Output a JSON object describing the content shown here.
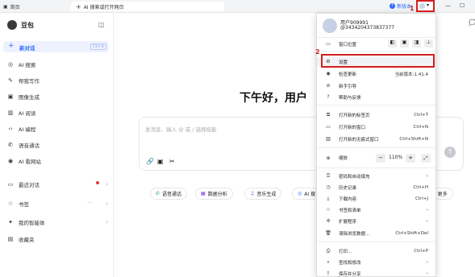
{
  "titlebar": {
    "home_tab": "首页",
    "new_tab": "AI 搜索或打开网页",
    "update_label": "新版本",
    "update_count": "1"
  },
  "sidebar": {
    "brand": "豆包",
    "new_chat": "新对话",
    "new_chat_shortcut": "Ctrl K",
    "items": [
      {
        "icon": "ai-search-icon",
        "glyph": "◎",
        "label": "AI 搜索"
      },
      {
        "icon": "pen-icon",
        "glyph": "✎",
        "label": "帮我写作"
      },
      {
        "icon": "image-icon",
        "glyph": "▣",
        "label": "图像生成"
      },
      {
        "icon": "book-icon",
        "glyph": "▥",
        "label": "AI 阅读"
      },
      {
        "icon": "code-icon",
        "glyph": "‹›",
        "label": "AI 编程"
      },
      {
        "icon": "phone-icon",
        "glyph": "✆",
        "label": "语音通话"
      },
      {
        "icon": "globe-icon",
        "glyph": "◉",
        "label": "AI 看网站"
      }
    ],
    "recent": "最近对话",
    "bookmarks": "书签",
    "agents": "我的智能体",
    "favorites": "收藏夹"
  },
  "main": {
    "greeting": "下午好，用户",
    "placeholder": "发消息、输入 @ 或 / 选择技能",
    "chips": [
      "语音通话",
      "数据分析",
      "音乐生成",
      "AI 搜",
      "更多"
    ]
  },
  "menu": {
    "user_name": "用户909991",
    "user_handle": "@3434204373837377",
    "window_position": "窗口位置",
    "settings": "设置",
    "check_update": "检查更新",
    "version": "当前版本:1.41.4",
    "guide": "新手引导",
    "help": "帮助与反馈",
    "new_tab": "打开新的标签页",
    "new_tab_sc": "Ctrl+T",
    "new_window": "打开新的窗口",
    "new_window_sc": "Ctrl+N",
    "incognito": "打开新的无痕式窗口",
    "incognito_sc": "Ctrl+Shift+N",
    "zoom": "缩放",
    "zoom_value": "110%",
    "autofill": "密码和自动填充",
    "history": "历史记录",
    "history_sc": "Ctrl+H",
    "downloads": "下载内容",
    "downloads_sc": "Ctrl+J",
    "bookmarks": "书签和清单",
    "extensions": "扩展程序",
    "clear_data": "清除浏览数据...",
    "clear_data_sc": "Ctrl+Shift+Del",
    "print": "打印...",
    "print_sc": "Ctrl+P",
    "find": "查找和修改",
    "save_share": "保存并分享"
  },
  "annotations": {
    "num1": "1",
    "num2": "2"
  },
  "colors": {
    "accent": "#2f6bff",
    "red_annotation": "#d21f1f"
  }
}
